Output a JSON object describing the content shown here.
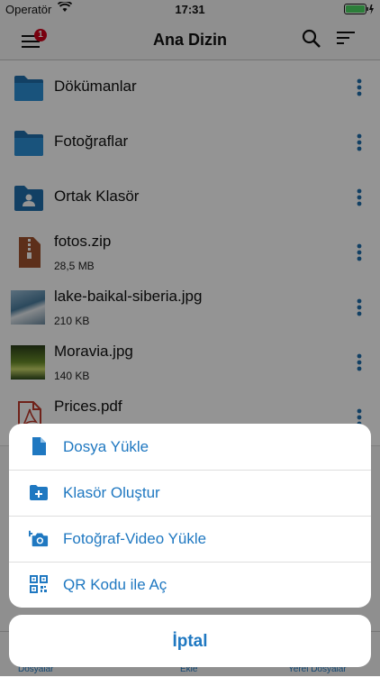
{
  "status": {
    "carrier": "Operatör",
    "time": "17:31"
  },
  "header": {
    "title": "Ana Dizin",
    "badge_count": "1"
  },
  "files": [
    {
      "name": "Dökümanlar",
      "size": "",
      "icon": "folder-icon"
    },
    {
      "name": "Fotoğraflar",
      "size": "",
      "icon": "folder-icon"
    },
    {
      "name": "Ortak Klasör",
      "size": "",
      "icon": "shared-folder-icon"
    },
    {
      "name": "fotos.zip",
      "size": "28,5 MB",
      "icon": "zip-file-icon"
    },
    {
      "name": "lake-baikal-siberia.jpg",
      "size": "210 KB",
      "icon": "image-thumbnail"
    },
    {
      "name": "Moravia.jpg",
      "size": "140 KB",
      "icon": "image-thumbnail"
    },
    {
      "name": "Prices.pdf",
      "size": "",
      "icon": "pdf-file-icon"
    }
  ],
  "action_sheet": {
    "items": [
      {
        "label": "Dosya Yükle",
        "icon": "file-icon"
      },
      {
        "label": "Klasör Oluştur",
        "icon": "folder-plus-icon"
      },
      {
        "label": "Fotoğraf-Video Yükle",
        "icon": "camera-plus-icon"
      },
      {
        "label": "QR Kodu ile Aç",
        "icon": "qr-code-icon"
      }
    ],
    "cancel": "İptal"
  },
  "tabbar": {
    "tabs": [
      "Dosyalar",
      "Ekle",
      "Yerel Dosyalar"
    ]
  },
  "colors": {
    "accent": "#1f78c1",
    "badge": "#d0021b",
    "battery": "#4cd964"
  }
}
